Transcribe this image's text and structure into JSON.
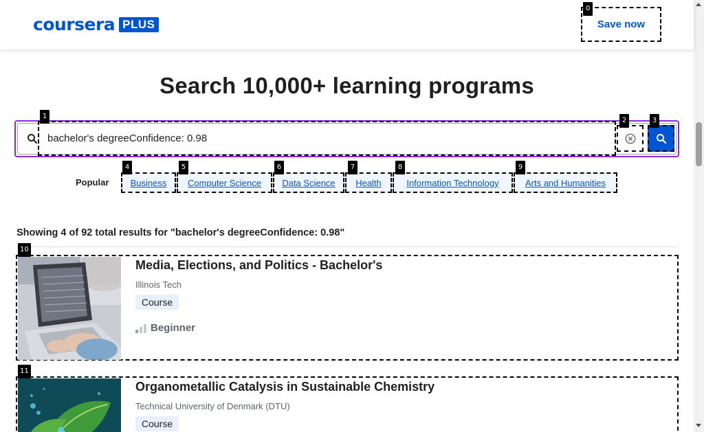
{
  "header": {
    "logo_text": "coursera",
    "logo_plus": "PLUS",
    "save_button": "Save now"
  },
  "badges": [
    "0",
    "1",
    "2",
    "3",
    "4",
    "5",
    "6",
    "7",
    "8",
    "9",
    "10",
    "11"
  ],
  "search": {
    "title": "Search 10,000+ learning programs",
    "value": "bachelor's degreeConfidence: 0.98",
    "placeholder": ""
  },
  "popular": {
    "label": "Popular",
    "items": [
      "Business",
      "Computer Science",
      "Data Science",
      "Health",
      "Information Technology",
      "Arts and Humanities"
    ]
  },
  "results": {
    "summary": "Showing 4 of 92 total results for \"bachelor's degreeConfidence: 0.98\"",
    "items": [
      {
        "title": "Media, Elections, and Politics - Bachelor's",
        "partner": "Illinois Tech",
        "type": "Course",
        "level": "Beginner"
      },
      {
        "title": "Organometallic Catalysis in Sustainable Chemistry",
        "partner": "Technical University of Denmark (DTU)",
        "type": "Course"
      }
    ]
  },
  "colors": {
    "brand": "#0056d2",
    "focus_outline": "#8a2be2",
    "chip_bg": "#f0f6ff"
  },
  "icons": {
    "search": "search-icon",
    "clear": "clear-circle-icon",
    "submit": "search-submit-icon",
    "level": "level-bars-icon"
  }
}
